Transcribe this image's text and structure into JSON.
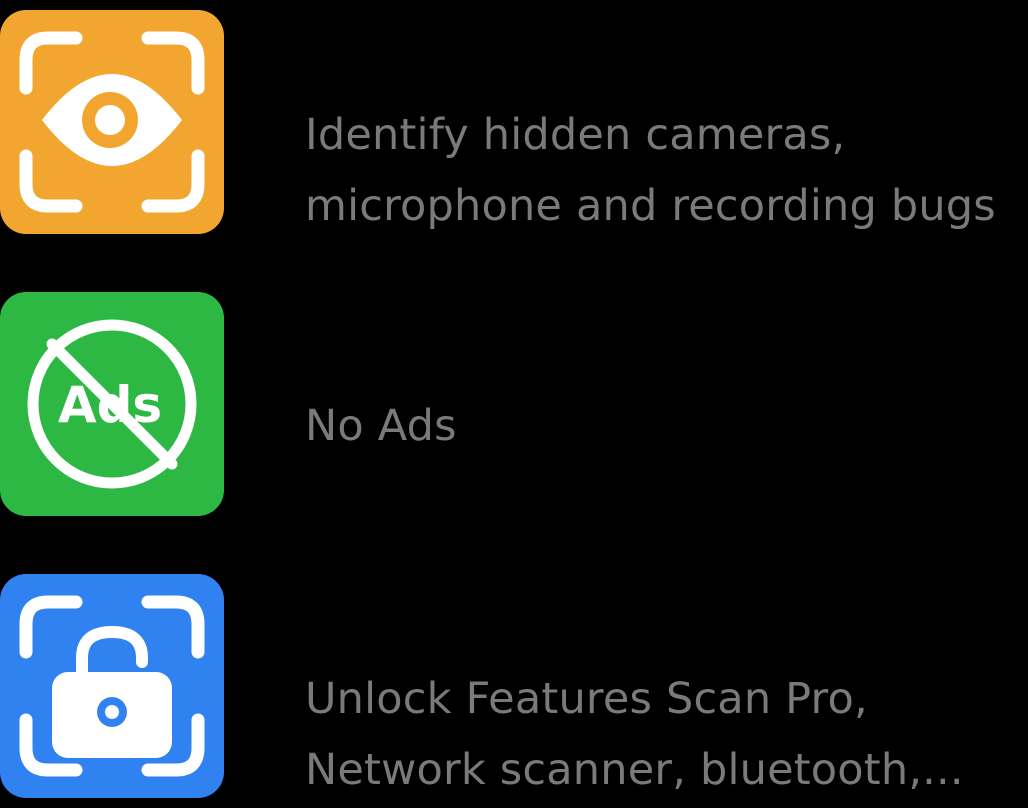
{
  "colors": {
    "background": "#000000",
    "text": "#7a7a7a",
    "detect_tile": "#f2a630",
    "no_ads_tile": "#2db843",
    "unlock_tile": "#2f82f0",
    "glyph": "#ffffff"
  },
  "features": [
    {
      "icon": "eye-scan-icon",
      "lines": [
        "Identify hidden cameras,",
        "microphone and recording bugs"
      ]
    },
    {
      "icon": "no-ads-icon",
      "icon_text": "Ads",
      "lines": [
        "No Ads"
      ]
    },
    {
      "icon": "unlock-scan-icon",
      "lines": [
        "Unlock Features Scan Pro,",
        "Network scanner, bluetooth,..."
      ]
    }
  ]
}
